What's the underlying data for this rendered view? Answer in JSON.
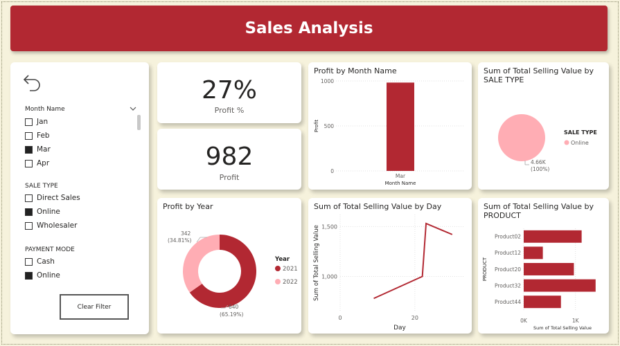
{
  "colors": {
    "accent": "#b22832",
    "pink": "#ffadb4",
    "card": "#ffffff",
    "background": "#f6f2dc"
  },
  "header": {
    "title": "Sales Analysis"
  },
  "filters": {
    "back_icon": "undo-arrow-icon",
    "month": {
      "title": "Month Name",
      "items": [
        {
          "label": "Jan",
          "checked": false
        },
        {
          "label": "Feb",
          "checked": false
        },
        {
          "label": "Mar",
          "checked": true
        },
        {
          "label": "Apr",
          "checked": false
        }
      ]
    },
    "sale_type": {
      "title": "SALE TYPE",
      "items": [
        {
          "label": "Direct Sales",
          "checked": false
        },
        {
          "label": "Online",
          "checked": true
        },
        {
          "label": "Wholesaler",
          "checked": false
        }
      ]
    },
    "payment_mode": {
      "title": "PAYMENT MODE",
      "items": [
        {
          "label": "Cash",
          "checked": false
        },
        {
          "label": "Online",
          "checked": true
        }
      ]
    },
    "clear_label": "Clear Filter"
  },
  "kpis": {
    "profit_pct": {
      "value": "27%",
      "label": "Profit %"
    },
    "profit": {
      "value": "982",
      "label": "Profit"
    }
  },
  "chart_data": [
    {
      "id": "profit_by_month",
      "type": "bar",
      "title": "Profit by Month Name",
      "categories": [
        "Mar"
      ],
      "values": [
        982
      ],
      "xlabel": "Month Name",
      "ylabel": "Profit",
      "ylim": [
        0,
        1000
      ],
      "yticks": [
        0,
        500,
        1000
      ],
      "grid": true
    },
    {
      "id": "selling_by_sale_type",
      "type": "pie",
      "title": "Sum of Total Selling Value by SALE TYPE",
      "legend_title": "SALE TYPE",
      "legend_position": "right",
      "labels": [
        "Online"
      ],
      "values": [
        4660
      ],
      "data_labels": [
        "4.66K",
        "(100%)"
      ]
    },
    {
      "id": "profit_by_year",
      "type": "pie",
      "donut": true,
      "title": "Profit by Year",
      "legend_title": "Year",
      "legend_position": "right",
      "labels": [
        "2021",
        "2022"
      ],
      "values": [
        640,
        342
      ],
      "data_labels": [
        {
          "value": "640",
          "pct": "(65.19%)"
        },
        {
          "value": "342",
          "pct": "(34.81%)"
        }
      ]
    },
    {
      "id": "selling_by_day",
      "type": "line",
      "title": "Sum of Total Selling Value by Day",
      "xlabel": "Day",
      "ylabel": "Sum of Total Selling Value",
      "x": [
        9,
        22,
        23,
        30
      ],
      "y": [
        780,
        1000,
        1530,
        1420
      ],
      "xlim": [
        0,
        33
      ],
      "ylim": [
        650,
        1620
      ],
      "xticks": [
        0,
        20
      ],
      "yticks": [
        1000,
        1500
      ],
      "ytick_labels": [
        "1,000",
        "1,500"
      ],
      "grid": true
    },
    {
      "id": "selling_by_product",
      "type": "bar",
      "orientation": "horizontal",
      "title": "Sum of Total Selling Value by PRODUCT",
      "categories": [
        "Product02",
        "Product12",
        "Product20",
        "Product32",
        "Product44"
      ],
      "values": [
        1120,
        370,
        970,
        1390,
        720
      ],
      "xlabel": "Sum of Total Selling Value",
      "ylabel": "PRODUCT",
      "xlim": [
        0,
        1500
      ],
      "xticks": [
        0,
        1000
      ],
      "xtick_labels": [
        "0K",
        "1K"
      ],
      "grid": true
    }
  ]
}
